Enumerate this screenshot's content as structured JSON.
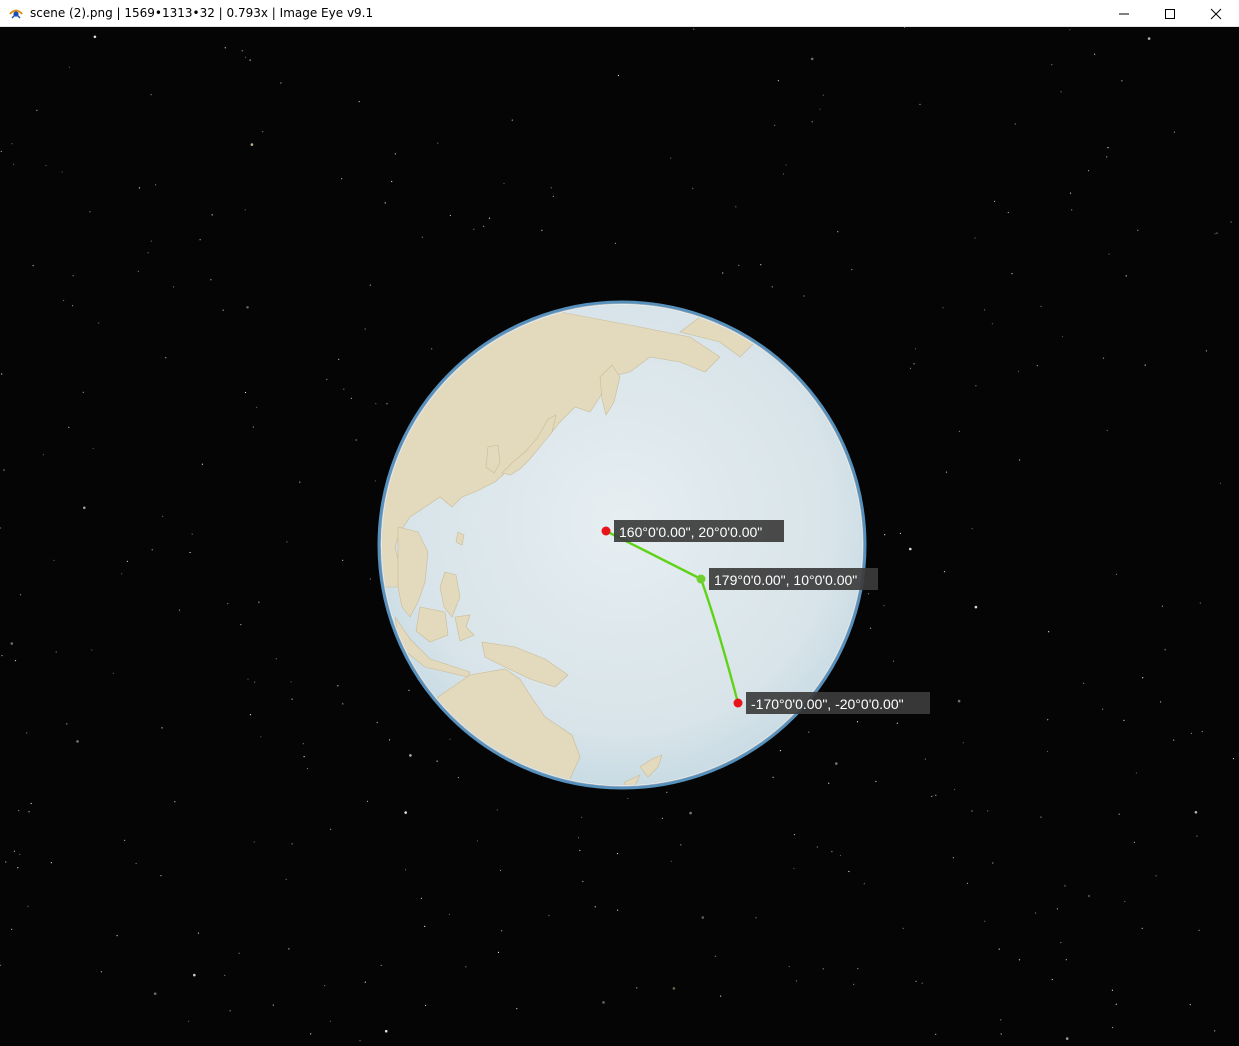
{
  "window": {
    "title": "scene (2).png | 1569•1313•32 | 0.793x | Image Eye v9.1",
    "app_icon": "image-eye-icon",
    "controls": {
      "minimize": "minimize-icon",
      "maximize": "maximize-icon",
      "close": "close-icon"
    }
  },
  "scene": {
    "background": "#050505",
    "globe_ocean_color": "#dce6ea",
    "globe_land_color": "#e3d9bd",
    "globe_rim_color": "#4a90c8",
    "route_color": "#5fd317",
    "point_color": "#e8141c",
    "midpoint_color": "#6fcf2f",
    "label_bg": "#3c3c3c",
    "points": [
      {
        "label": "160°0'0.00\", 20°0'0.00\"",
        "lon": 160,
        "lat": 20
      },
      {
        "label": "179°0'0.00\", 10°0'0.00\"",
        "lon": 179,
        "lat": 10
      },
      {
        "label": "-170°0'0.00\", -20°0'0.00\"",
        "lon": -170,
        "lat": -20
      }
    ]
  }
}
